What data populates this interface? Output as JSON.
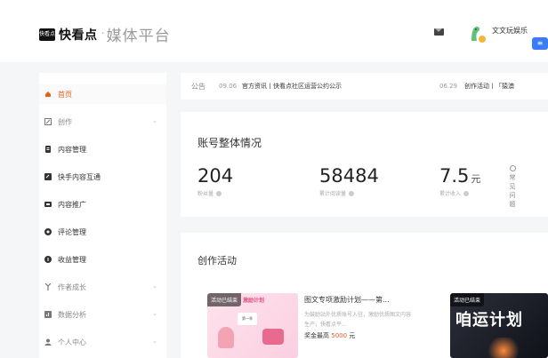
{
  "header": {
    "logo_mark": "快看点",
    "brand": "快看点",
    "separator": "·",
    "platform": "媒体平台",
    "user_name": "文文玩娱乐",
    "user_badge": "≡"
  },
  "sidebar": {
    "items": [
      {
        "label": "首页",
        "icon": "home-icon",
        "active": true,
        "expandable": false
      },
      {
        "label": "创作",
        "icon": "create-icon",
        "active": false,
        "expandable": true
      },
      {
        "label": "内容管理",
        "icon": "content-icon",
        "active": false,
        "expandable": false
      },
      {
        "label": "快手内容互通",
        "icon": "sync-icon",
        "active": false,
        "expandable": false
      },
      {
        "label": "内容推广",
        "icon": "promote-icon",
        "active": false,
        "expandable": false
      },
      {
        "label": "评论管理",
        "icon": "comment-icon",
        "active": false,
        "expandable": false
      },
      {
        "label": "收益管理",
        "icon": "income-icon",
        "active": false,
        "expandable": false
      },
      {
        "label": "作者成长",
        "icon": "growth-icon",
        "active": false,
        "expandable": true
      },
      {
        "label": "数据分析",
        "icon": "analytics-icon",
        "active": false,
        "expandable": true
      },
      {
        "label": "个人中心",
        "icon": "user-icon",
        "active": false,
        "expandable": true
      }
    ],
    "chevron": "⌄"
  },
  "notice": {
    "title": "公告",
    "date1": "09.06",
    "text1": "官方资讯丨快看点社区运营公约公示",
    "date2": "06.29",
    "text2": "创作活动丨「猿澳"
  },
  "overview": {
    "title": "账号整体情况",
    "stats": [
      {
        "value": "204",
        "unit": "",
        "label": "粉丝量"
      },
      {
        "value": "58484",
        "unit": "",
        "label": "累计阅读量"
      },
      {
        "value": "7.5",
        "unit": "元",
        "label": "累计收入"
      }
    ],
    "faq": "常见问题"
  },
  "activities": {
    "title": "创作活动",
    "items": [
      {
        "tag": "活动已结束",
        "banner": "激励计划",
        "card": "第一季",
        "name": "图文专项激励计划——第...",
        "desc": "为鼓励站外优质账号入驻，激励优质图文内容生产，快看点平...",
        "reward_prefix": "奖金最高",
        "reward_amount": "5000",
        "reward_suffix": "元"
      },
      {
        "tag": "活动已结束",
        "big_text": "咱运计划"
      }
    ]
  }
}
